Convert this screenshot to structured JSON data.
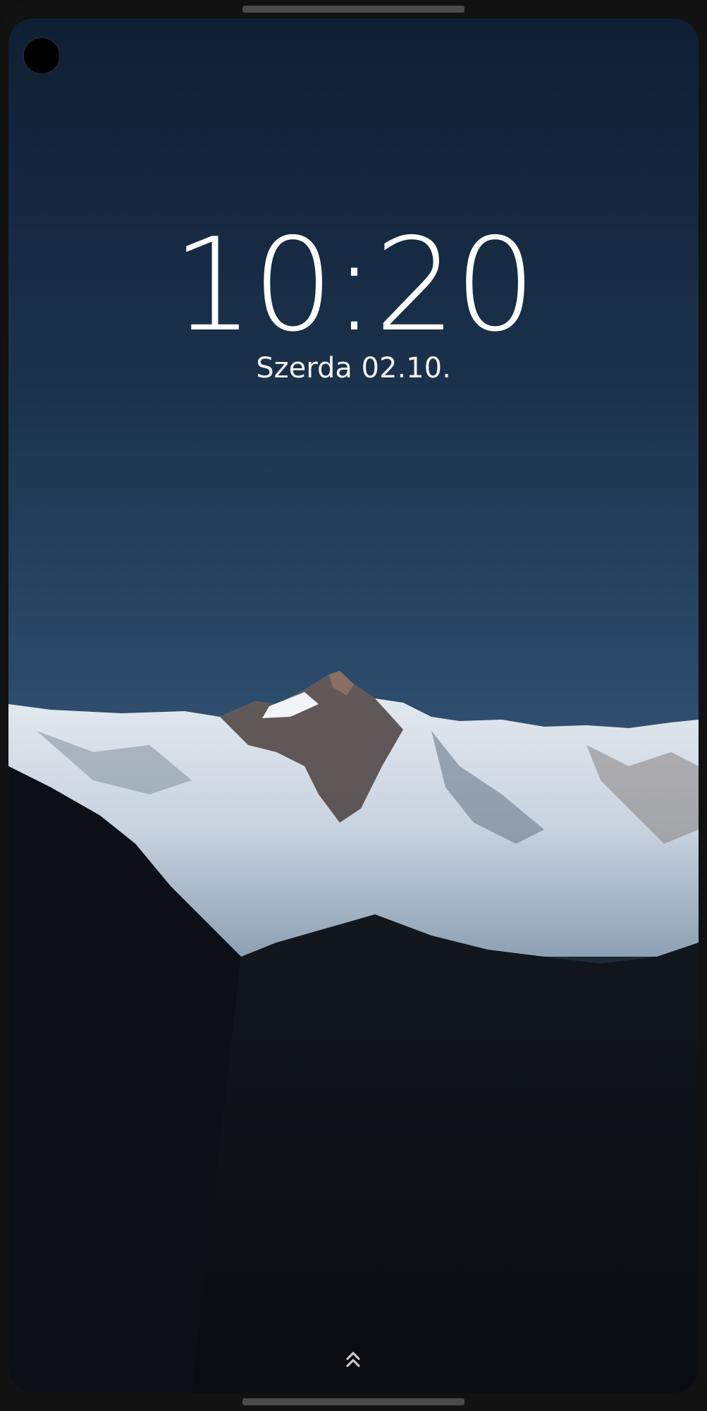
{
  "lockscreen": {
    "time": "10:20",
    "date": "Szerda 02.10."
  },
  "icons": {
    "camera": "front-camera-icon",
    "swipe_up": "double-chevron-up-icon"
  },
  "colors": {
    "clock_text": "#ffffff",
    "sky_top": "#0f1f33",
    "sky_bottom": "#3b5a78",
    "foreground_dark": "#0a0d12"
  }
}
